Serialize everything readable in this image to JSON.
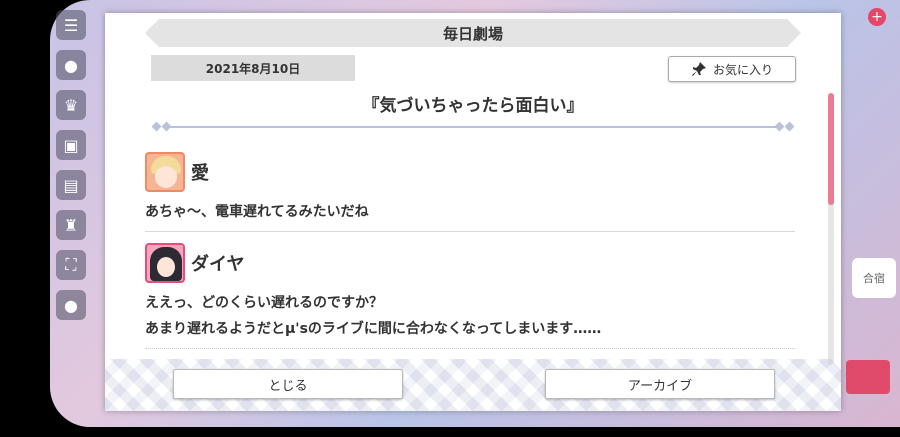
{
  "window": {
    "title": "毎日劇場"
  },
  "header": {
    "date": "2021年8月10日",
    "favorite_label": "お気に入り",
    "favorite_icon": "pin-icon"
  },
  "episode": {
    "title": "『気づいちゃったら面白い』"
  },
  "dialogue": [
    {
      "speaker": "愛",
      "lines": [
        "あちゃ〜、電車遅れてるみたいだね"
      ]
    },
    {
      "speaker": "ダイヤ",
      "lines": [
        "ええっ、どのくらい遅れるのですか？",
        "あまり遅れるようだとμ'sのライブに間に合わなくなってしまいます……"
      ]
    }
  ],
  "footer": {
    "close_label": "とじる",
    "archive_label": "アーカイブ"
  },
  "background": {
    "right_tag": "合宿"
  },
  "colors": {
    "accent": "#ee7b93",
    "title_bar": "#e4e4e4"
  }
}
